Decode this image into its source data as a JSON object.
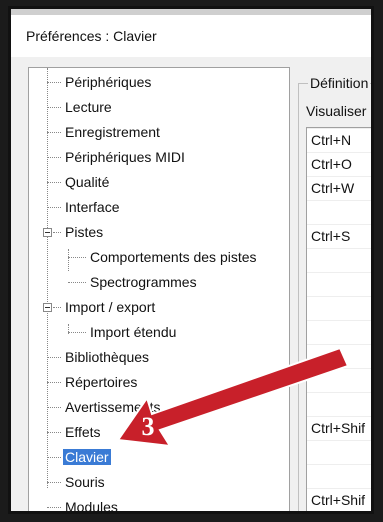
{
  "window": {
    "title": "Préférences : Clavier"
  },
  "tree": {
    "items": [
      {
        "label": "Périphériques"
      },
      {
        "label": "Lecture"
      },
      {
        "label": "Enregistrement"
      },
      {
        "label": "Périphériques MIDI"
      },
      {
        "label": "Qualité"
      },
      {
        "label": "Interface"
      },
      {
        "label": "Pistes"
      },
      {
        "label": "Comportements des pistes"
      },
      {
        "label": "Spectrogrammes"
      },
      {
        "label": "Import / export"
      },
      {
        "label": "Import étendu"
      },
      {
        "label": "Bibliothèques"
      },
      {
        "label": "Répertoires"
      },
      {
        "label": "Avertissements"
      },
      {
        "label": "Effets"
      },
      {
        "label": "Clavier"
      },
      {
        "label": "Souris"
      },
      {
        "label": "Modules"
      }
    ],
    "selected": "Clavier"
  },
  "panel": {
    "group_label": "Définition",
    "visualiser_label": "Visualiser",
    "shortcuts": [
      "Ctrl+N",
      "Ctrl+O",
      "Ctrl+W",
      "",
      "Ctrl+S",
      "",
      "",
      "",
      "",
      "",
      "",
      "",
      "Ctrl+Shif",
      "",
      "",
      "Ctrl+Shif"
    ]
  },
  "annotation": {
    "step_number": "3",
    "arrow_color": "#c8202a"
  },
  "colors": {
    "selection": "#3a7bd5",
    "background": "#f0f0f0"
  }
}
